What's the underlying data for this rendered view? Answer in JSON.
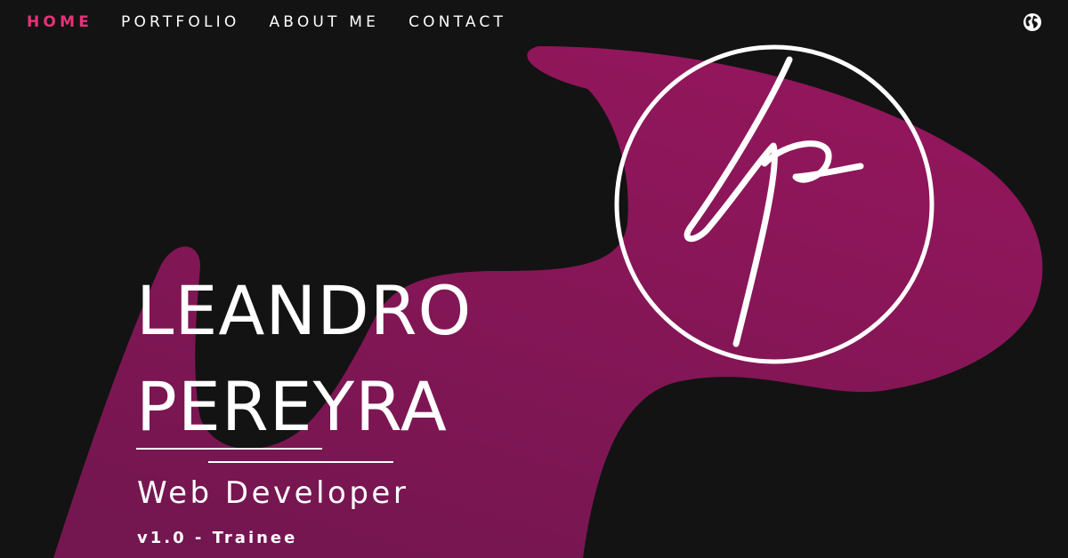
{
  "nav": {
    "items": [
      {
        "label": "HOME",
        "active": true
      },
      {
        "label": "PORTFOLIO",
        "active": false
      },
      {
        "label": "ABOUT ME",
        "active": false
      },
      {
        "label": "CONTACT",
        "active": false
      }
    ]
  },
  "header": {
    "language_icon": "globe-icon"
  },
  "hero": {
    "name_line_1": "LEANDRO",
    "name_line_2": "PEREYRA",
    "role": "Web Developer",
    "version": "v1.0 - Trainee",
    "logo_icon": "lp-monogram-logo"
  },
  "colors": {
    "background": "#131313",
    "accent": "#e8317a",
    "blob": "#8c1759",
    "text": "#ffffff"
  }
}
